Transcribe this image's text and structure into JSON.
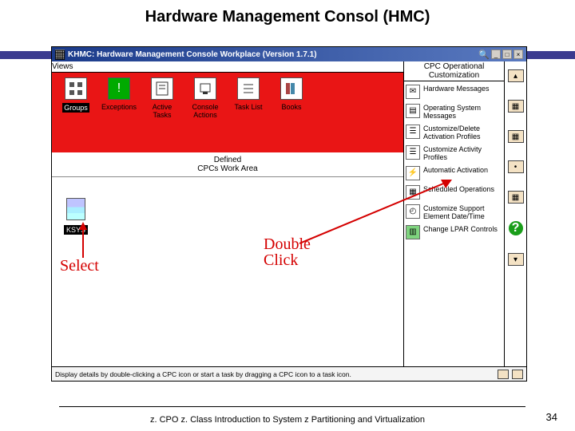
{
  "slide": {
    "title": "Hardware Management Consol (HMC)",
    "footer": "z. CPO z. Class  Introduction to System z Partitioning and Virtualization",
    "page": "34"
  },
  "titlebar": {
    "text": "KHMC: Hardware Management Console Workplace (Version 1.7.1)"
  },
  "headers": {
    "views": "Views",
    "workarea_line1": "Defined",
    "workarea_line2": "CPCs Work Area",
    "tasks_panel": "CPC Operational Customization"
  },
  "views": [
    {
      "label": "Groups",
      "icon": "groups",
      "selected": true
    },
    {
      "label": "Exceptions",
      "icon": "exceptions"
    },
    {
      "label": "Active Tasks",
      "icon": "active"
    },
    {
      "label": "Console Actions",
      "icon": "console"
    },
    {
      "label": "Task List",
      "icon": "tasklist"
    },
    {
      "label": "Books",
      "icon": "books"
    }
  ],
  "cpc": {
    "label": "KSYS"
  },
  "tasks": [
    {
      "label": "Hardware Messages",
      "icon": "msg"
    },
    {
      "label": "Operating System Messages",
      "icon": "osmsg"
    },
    {
      "label": "Customize/Delete Activation Profiles",
      "icon": "profiles"
    },
    {
      "label": "Customize Activity Profiles",
      "icon": "activity"
    },
    {
      "label": "Automatic Activation",
      "icon": "auto"
    },
    {
      "label": "Scheduled Operations",
      "icon": "sched"
    },
    {
      "label": "Customize Support Element Date/Time",
      "icon": "clock"
    },
    {
      "label": "Change LPAR Controls",
      "icon": "lpar"
    }
  ],
  "statusbar": {
    "text": "Display details by double-clicking a CPC icon or start a task by dragging a CPC icon to a task icon."
  },
  "annotations": {
    "select": "Select",
    "double_click": "Double Click"
  }
}
